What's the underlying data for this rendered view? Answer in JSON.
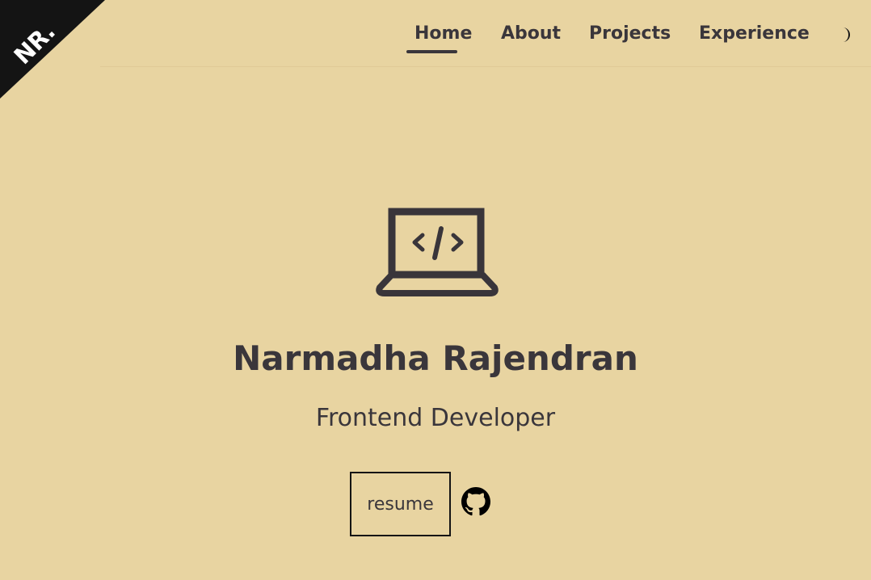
{
  "logo": {
    "text": "NR."
  },
  "nav": {
    "items": [
      {
        "label": "Home",
        "active": true
      },
      {
        "label": "About"
      },
      {
        "label": "Projects"
      },
      {
        "label": "Experience"
      }
    ],
    "theme_toggle_icon": "moon-icon"
  },
  "hero": {
    "icon": "laptop-code-icon",
    "icon_code_text": "</>",
    "name": "Narmadha Rajendran",
    "title": "Frontend Developer",
    "resume_label": "resume",
    "github_icon": "github-icon"
  },
  "colors": {
    "background": "#e8d4a1",
    "text": "#3a363b",
    "corner": "#141414",
    "logo_text": "#ffffff"
  }
}
